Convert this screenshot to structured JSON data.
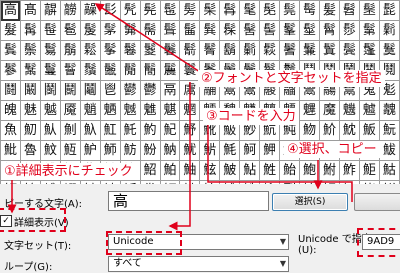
{
  "char_grid": [
    [
      "高",
      "髙",
      "髜",
      "髝",
      "髞",
      "髟",
      "髠",
      "髡",
      "髢",
      "髣",
      "髤",
      "髥",
      "髦",
      "髧",
      "髨",
      "髩",
      "髪",
      "髫",
      "髬",
      "髭"
    ],
    [
      "髮",
      "髯",
      "髰",
      "髱",
      "髲",
      "髳",
      "髴",
      "髵",
      "髶",
      "髷",
      "髸",
      "髹",
      "髺",
      "髻",
      "髼",
      "髽",
      "髾",
      "髿",
      "鬀",
      "鬁"
    ],
    [
      "鬂",
      "鬃",
      "鬄",
      "鬅",
      "鬆",
      "鬇",
      "鬈",
      "鬉",
      "鬊",
      "鬋",
      "鬌",
      "鬍",
      "鬎",
      "鬏",
      "鬐",
      "鬑",
      "鬒",
      "鬓",
      "鬔",
      "鬕"
    ],
    [
      "鬖",
      "鬗",
      "鬘",
      "鬙",
      "鬚",
      "鬛",
      "鬜",
      "鬝",
      "鬞",
      "鬟",
      "鬠",
      "鬡",
      "鬢",
      "鬣",
      "鬤",
      "鬥",
      "鬦",
      "鬧",
      "鬨",
      "鬩"
    ],
    [
      "鬪",
      "鬫",
      "鬬",
      "鬭",
      "鬮",
      "鬯",
      "鬰",
      "鬱",
      "鬲",
      "鬳",
      "鬴",
      "鬵",
      "鬶",
      "鬷",
      "鬸",
      "鬹",
      "鬺",
      "鬻",
      "鬼",
      "鬽"
    ],
    [
      "魄",
      "魅",
      "魆",
      "魇",
      "魈",
      "魉",
      "魊",
      "魋",
      "魌",
      "魍",
      "魎",
      "魏",
      "魐",
      "魑",
      "魒",
      "魓",
      "魔",
      "魕",
      "魖",
      "魗"
    ],
    [
      "魚",
      "魛",
      "魜",
      "魝",
      "魞",
      "魟",
      "魠",
      "魡",
      "魢",
      "魣",
      "魤",
      "魥",
      "魦",
      "魧",
      "魨",
      "魩",
      "魪",
      "魫",
      "魬",
      "魭"
    ],
    [
      "魮",
      "魯",
      "魰",
      "魱",
      "魲",
      "魳",
      "魴",
      "魵",
      "魶",
      "魷",
      "魸",
      "魹",
      "魺",
      "魻",
      "魼",
      "魽",
      "魾",
      "魿",
      "鮀",
      "鮁"
    ],
    [
      "鮂",
      "鮃",
      "鮄",
      "鮅",
      "鮆",
      "鮇",
      "鮈",
      "鮉",
      "鮊",
      "鮋",
      "鮌",
      "鮍",
      "鮎",
      "鮏",
      "鮐",
      "鮑",
      "鮒",
      "鮓",
      "鮔",
      "鮕"
    ],
    [
      "鮖",
      "鮗",
      "鮘",
      "鮙",
      "鮚",
      "鮛",
      "鮜",
      "鮝",
      "鮞",
      "鮟",
      "鮠",
      "鮡",
      "鮢",
      "鮣",
      "鮤",
      "鮥",
      "鮦",
      "鮧",
      "鮨",
      "鮩"
    ]
  ],
  "callouts": {
    "font_and_charset": "②フォントと文字セットを指定",
    "enter_code": "③コードを入力",
    "select_copy": "④選択、コピー",
    "check_detail": "①詳細表示にチェック"
  },
  "controls": {
    "chars_to_copy_label": "ピーする文字(A):",
    "chars_to_copy_value": "高",
    "select_button": "選択(S)",
    "detail_view_label": "詳細表示(V)",
    "charset_label": "文字セット(T):",
    "charset_value": "Unicode",
    "unicode_goto_label": "Unicode で指定",
    "unicode_goto_shortcut": "(U):",
    "unicode_goto_value": "9AD9",
    "group_label": "ループ(G):",
    "group_value": "すべて"
  },
  "colors": {
    "annotation_red": "#e0001b"
  }
}
